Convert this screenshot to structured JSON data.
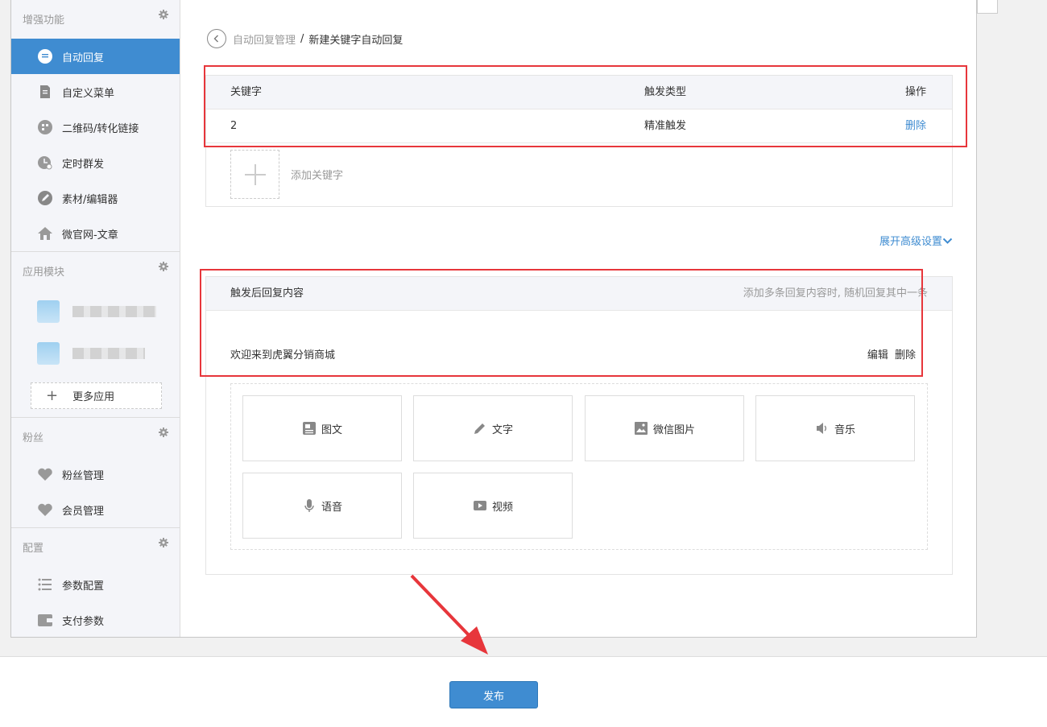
{
  "sidebar": {
    "groups": [
      {
        "title": "增强功能",
        "items": [
          {
            "label": "自动回复",
            "icon": "chat-bubble-icon",
            "active": true
          },
          {
            "label": "自定义菜单",
            "icon": "document-icon"
          },
          {
            "label": "二维码/转化链接",
            "icon": "qrcode-icon"
          },
          {
            "label": "定时群发",
            "icon": "clock-icon"
          },
          {
            "label": "素材/编辑器",
            "icon": "pencil-icon"
          },
          {
            "label": "微官网-文章",
            "icon": "home-icon"
          }
        ]
      },
      {
        "title": "应用模块",
        "more_apps": "更多应用"
      },
      {
        "title": "粉丝",
        "items": [
          {
            "label": "粉丝管理",
            "icon": "heart-icon"
          },
          {
            "label": "会员管理",
            "icon": "heart-icon"
          }
        ]
      },
      {
        "title": "配置",
        "items": [
          {
            "label": "参数配置",
            "icon": "list-icon"
          },
          {
            "label": "支付参数",
            "icon": "wallet-icon"
          }
        ]
      }
    ]
  },
  "breadcrumb": {
    "parent": "自动回复管理",
    "separator": "/",
    "current": "新建关键字自动回复"
  },
  "keywords": {
    "headers": {
      "keyword": "关键字",
      "trigger_type": "触发类型",
      "action": "操作"
    },
    "rows": [
      {
        "keyword": "2",
        "trigger_type": "精准触发",
        "action": "删除"
      }
    ],
    "add_label": "添加关键字"
  },
  "advanced_toggle": "展开高级设置",
  "reply": {
    "title": "触发后回复内容",
    "hint": "添加多条回复内容时, 随机回复其中一条",
    "item_text": "欢迎来到虎翼分销商城",
    "edit_label": "编辑",
    "delete_label": "删除",
    "types": [
      {
        "label": "图文",
        "icon": "image-text-icon"
      },
      {
        "label": "文字",
        "icon": "pencil-icon"
      },
      {
        "label": "微信图片",
        "icon": "picture-icon"
      },
      {
        "label": "音乐",
        "icon": "speaker-icon"
      },
      {
        "label": "语音",
        "icon": "microphone-icon"
      },
      {
        "label": "视频",
        "icon": "video-icon"
      }
    ]
  },
  "publish_label": "发布",
  "colors": {
    "accent": "#3f8cd1",
    "annotation": "#e7363b"
  }
}
